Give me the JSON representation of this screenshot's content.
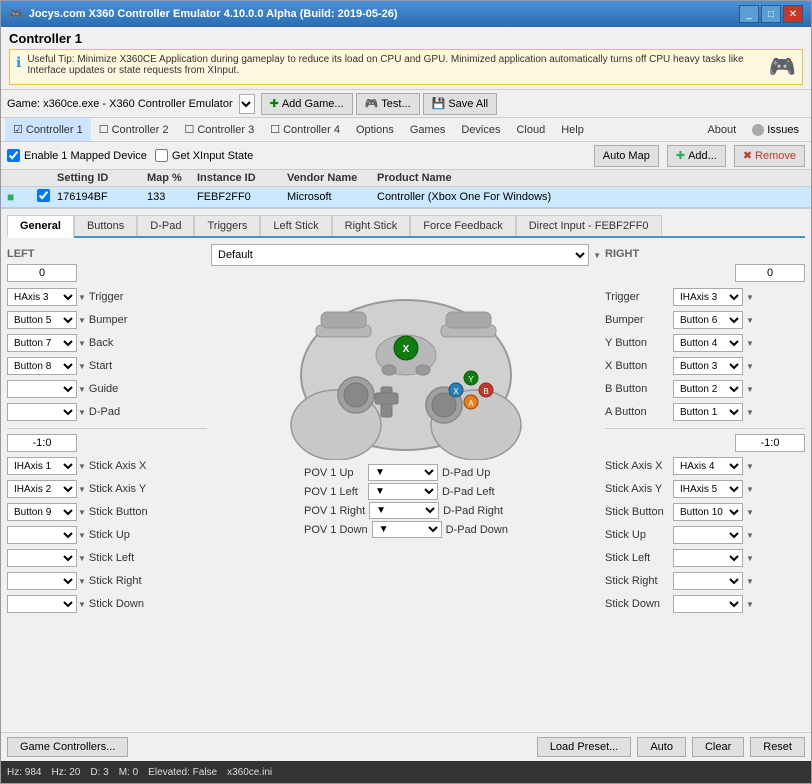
{
  "window": {
    "title": "Jocys.com X360 Controller Emulator 4.10.0.0 Alpha (Build: 2019-05-26)",
    "controller_title": "Controller 1",
    "tip_text": "Useful Tip: Minimize X360CE Application during gameplay to reduce its load on CPU and GPU. Minimized application automatically turns off CPU heavy tasks like Interface updates or state requests from XInput.",
    "game_name": "Game:  x360ce.exe - X360 Controller Emulator"
  },
  "toolbar": {
    "add_game": "Add Game...",
    "test": "Test...",
    "save_all": "Save All"
  },
  "menu": {
    "items": [
      "Controller 1",
      "Controller 2",
      "Controller 3",
      "Controller 4",
      "Options",
      "Games",
      "Devices",
      "Cloud",
      "Help",
      "About",
      "Issues"
    ]
  },
  "actions": {
    "enable_mapped": "Enable 1 Mapped Device",
    "get_xinput": "Get XInput State",
    "auto_map": "Auto Map",
    "add": "Add...",
    "remove": "Remove"
  },
  "device_table": {
    "headers": [
      "",
      "",
      "Setting ID",
      "Map %",
      "Instance ID",
      "Vendor Name",
      "Product Name"
    ],
    "row": {
      "setting_id": "176194BF",
      "map_pct": "133",
      "instance_id": "FEBF2FF0",
      "vendor_name": "Microsoft",
      "product_name": "Controller (Xbox One For Windows)"
    }
  },
  "tabs": [
    "General",
    "Buttons",
    "D-Pad",
    "Triggers",
    "Left Stick",
    "Right Stick",
    "Force Feedback",
    "Direct Input - FEBF2FF0"
  ],
  "active_tab": "General",
  "left_panel": {
    "label": "LEFT",
    "value": "0",
    "rows": [
      {
        "select": "HAxis 3",
        "label": "Trigger"
      },
      {
        "select": "Button 5",
        "label": "Bumper"
      },
      {
        "select": "Button 7",
        "label": "Back"
      },
      {
        "select": "Button 8",
        "label": "Start"
      },
      {
        "select": "",
        "label": "Guide"
      },
      {
        "select": "",
        "label": "D-Pad"
      }
    ],
    "stick_value": "-1:0",
    "stick_rows": [
      {
        "select": "IHAxis 1",
        "label": "Stick Axis X"
      },
      {
        "select": "IHAxis 2",
        "label": "Stick Axis Y"
      },
      {
        "select": "Button 9",
        "label": "Stick Button"
      },
      {
        "select": "",
        "label": "Stick Up"
      },
      {
        "select": "",
        "label": "Stick Left"
      },
      {
        "select": "",
        "label": "Stick Right"
      },
      {
        "select": "",
        "label": "Stick Down"
      }
    ]
  },
  "right_panel": {
    "label": "RIGHT",
    "value": "0",
    "rows": [
      {
        "label": "Trigger",
        "select": "IHAxis 3"
      },
      {
        "label": "Bumper",
        "select": "Button 6"
      },
      {
        "label": "Y Button",
        "select": "Button 4"
      },
      {
        "label": "X Button",
        "select": "Button 3"
      },
      {
        "label": "B Button",
        "select": "Button 2"
      },
      {
        "label": "A Button",
        "select": "Button 1"
      }
    ],
    "stick_value": "-1:0",
    "stick_rows": [
      {
        "label": "Stick Axis X",
        "select": "HAxis 4"
      },
      {
        "label": "Stick Axis Y",
        "select": "IHAxis 5"
      },
      {
        "label": "Stick Button",
        "select": "Button 10"
      },
      {
        "label": "Stick Up",
        "select": ""
      },
      {
        "label": "Stick Left",
        "select": ""
      },
      {
        "label": "Stick Right",
        "select": ""
      },
      {
        "label": "Stick Down",
        "select": ""
      }
    ]
  },
  "middle": {
    "preset_label": "Default",
    "dpad_rows": [
      {
        "pov": "POV 1 Up",
        "value": "D-Pad Up"
      },
      {
        "pov": "POV 1 Left",
        "value": "D-Pad Left"
      },
      {
        "pov": "POV 1 Right",
        "value": "D-Pad Right"
      },
      {
        "pov": "POV 1 Down",
        "value": "D-Pad Down"
      }
    ]
  },
  "bottom_buttons": {
    "game_controllers": "Game Controllers...",
    "load_preset": "Load Preset...",
    "auto": "Auto",
    "clear": "Clear",
    "reset": "Reset"
  },
  "status_bar": {
    "hz": "Hz: 984",
    "frame": "Hz: 20",
    "d": "D: 3",
    "m": "M: 0",
    "elevated": "Elevated: False",
    "app": "x360ce.ini"
  }
}
